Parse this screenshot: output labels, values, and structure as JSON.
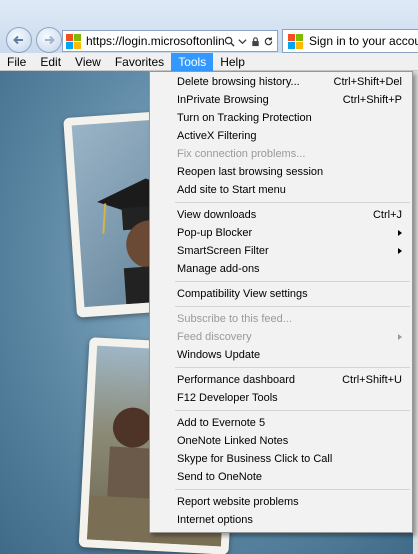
{
  "nav": {
    "back_icon": "back-arrow-icon",
    "forward_icon": "forward-arrow-icon"
  },
  "address_bar": {
    "url": "https://login.microsoftonline....",
    "search_icon": "search-icon",
    "dropdown_icon": "chevron-down-icon",
    "lock_icon": "lock-icon",
    "refresh_icon": "refresh-icon"
  },
  "tab": {
    "title": "Sign in to your account"
  },
  "brand_colors": {
    "ms_red": "#f25022",
    "ms_green": "#7fba00",
    "ms_blue": "#00a4ef",
    "ms_yellow": "#ffb900",
    "menu_highlight": "#3399ff"
  },
  "menubar": {
    "items": [
      {
        "label": "File"
      },
      {
        "label": "Edit"
      },
      {
        "label": "View"
      },
      {
        "label": "Favorites"
      },
      {
        "label": "Tools"
      },
      {
        "label": "Help"
      }
    ]
  },
  "tools_menu": {
    "groups": [
      [
        {
          "label": "Delete browsing history...",
          "shortcut": "Ctrl+Shift+Del"
        },
        {
          "label": "InPrivate Browsing",
          "shortcut": "Ctrl+Shift+P"
        },
        {
          "label": "Turn on Tracking Protection",
          "shortcut": ""
        },
        {
          "label": "ActiveX Filtering",
          "shortcut": ""
        },
        {
          "label": "Fix connection problems...",
          "shortcut": "",
          "disabled": true
        },
        {
          "label": "Reopen last browsing session",
          "shortcut": ""
        },
        {
          "label": "Add site to Start menu",
          "shortcut": ""
        }
      ],
      [
        {
          "label": "View downloads",
          "shortcut": "Ctrl+J"
        },
        {
          "label": "Pop-up Blocker",
          "shortcut": "",
          "submenu": true
        },
        {
          "label": "SmartScreen Filter",
          "shortcut": "",
          "submenu": true
        },
        {
          "label": "Manage add-ons",
          "shortcut": ""
        }
      ],
      [
        {
          "label": "Compatibility View settings",
          "shortcut": ""
        }
      ],
      [
        {
          "label": "Subscribe to this feed...",
          "shortcut": "",
          "disabled": true
        },
        {
          "label": "Feed discovery",
          "shortcut": "",
          "disabled": true,
          "submenu": true
        },
        {
          "label": "Windows Update",
          "shortcut": ""
        }
      ],
      [
        {
          "label": "Performance dashboard",
          "shortcut": "Ctrl+Shift+U"
        },
        {
          "label": "F12 Developer Tools",
          "shortcut": ""
        }
      ],
      [
        {
          "label": "Add to Evernote 5",
          "shortcut": ""
        },
        {
          "label": "OneNote Linked Notes",
          "shortcut": ""
        },
        {
          "label": "Skype for Business Click to Call",
          "shortcut": ""
        },
        {
          "label": "Send to OneNote",
          "shortcut": ""
        }
      ],
      [
        {
          "label": "Report website problems",
          "shortcut": ""
        },
        {
          "label": "Internet options",
          "shortcut": ""
        }
      ]
    ]
  }
}
